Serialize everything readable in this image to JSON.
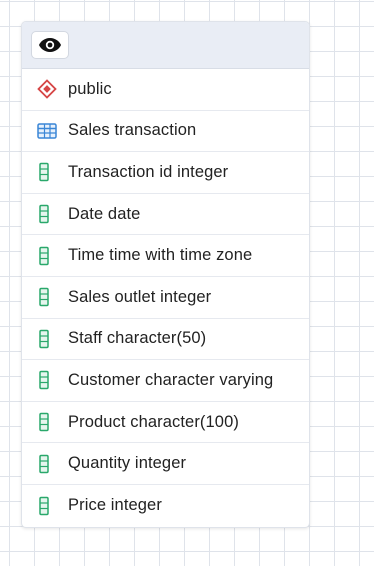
{
  "node": {
    "header": {
      "eye_icon": "eye-icon"
    },
    "schema": {
      "icon": "schema-icon",
      "label": "public",
      "color": "#d64545"
    },
    "table": {
      "icon": "table-icon",
      "label": "Sales transaction",
      "color": "#3a86d6"
    },
    "columns": [
      {
        "label": "Transaction id integer",
        "icon": "column-icon"
      },
      {
        "label": "Date date",
        "icon": "column-icon"
      },
      {
        "label": "Time time with time zone",
        "icon": "column-icon"
      },
      {
        "label": "Sales outlet integer",
        "icon": "column-icon"
      },
      {
        "label": "Staff character(50)",
        "icon": "column-icon"
      },
      {
        "label": "Customer character varying",
        "icon": "column-icon"
      },
      {
        "label": "Product character(100)",
        "icon": "column-icon"
      },
      {
        "label": "Quantity integer",
        "icon": "column-icon"
      },
      {
        "label": "Price integer",
        "icon": "column-icon"
      }
    ],
    "column_icon_color": "#2aa86b"
  }
}
